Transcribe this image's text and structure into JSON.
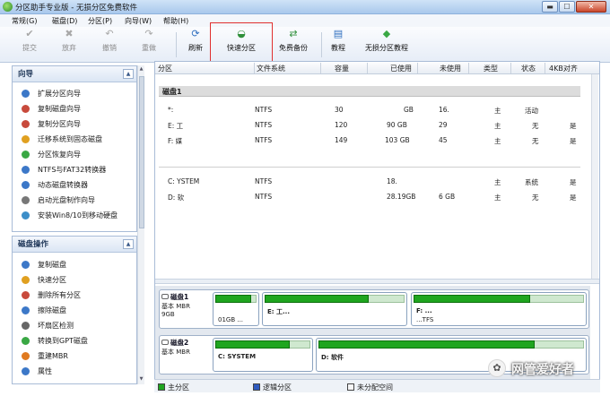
{
  "window": {
    "title": "分区助手专业版 - 无损分区免费软件",
    "min_label": "▬",
    "max_label": "☐",
    "close_label": "✕"
  },
  "menu": [
    "常规(G)",
    "磁盘(D)",
    "分区(P)",
    "向导(W)",
    "帮助(H)"
  ],
  "toolbar": [
    {
      "label": "提交",
      "icon": "commit-icon",
      "glyph": "✔",
      "enabled": false
    },
    {
      "label": "放弃",
      "icon": "discard-icon",
      "glyph": "✖",
      "enabled": false
    },
    {
      "label": "撤销",
      "icon": "undo-icon",
      "glyph": "↶",
      "enabled": false
    },
    {
      "label": "重做",
      "icon": "redo-icon",
      "glyph": "↷",
      "enabled": false
    },
    {
      "label": "刷新",
      "icon": "refresh-icon",
      "glyph": "⟳",
      "enabled": true
    },
    {
      "label": "快速分区",
      "icon": "quick-partition-icon",
      "glyph": "◒",
      "enabled": true
    },
    {
      "label": "免费备份",
      "icon": "backup-icon",
      "glyph": "⇄",
      "enabled": true
    },
    {
      "label": "教程",
      "icon": "tutorial-icon",
      "glyph": "▤",
      "enabled": true
    },
    {
      "label": "无损分区教程",
      "icon": "lossless-tutorial-icon",
      "glyph": "◆",
      "enabled": true
    }
  ],
  "sidebar": {
    "wizard": {
      "title": "向导",
      "items": [
        {
          "label": "扩展分区向导",
          "color": "#3c78c8"
        },
        {
          "label": "复制磁盘向导",
          "color": "#c84a3c"
        },
        {
          "label": "复制分区向导",
          "color": "#c84a3c"
        },
        {
          "label": "迁移系统到固态磁盘",
          "color": "#e0a020"
        },
        {
          "label": "分区恢复向导",
          "color": "#3aa844"
        },
        {
          "label": "NTFS与FAT32转换器",
          "color": "#3c78c8"
        },
        {
          "label": "动态磁盘转换器",
          "color": "#3c78c8"
        },
        {
          "label": "启动光盘制作向导",
          "color": "#777777"
        },
        {
          "label": "安装Win8/10到移动硬盘",
          "color": "#3c8ec8"
        }
      ]
    },
    "disk_ops": {
      "title": "磁盘操作",
      "items": [
        {
          "label": "复制磁盘",
          "color": "#3c78c8"
        },
        {
          "label": "快速分区",
          "color": "#e0a020"
        },
        {
          "label": "删除所有分区",
          "color": "#c84a3c"
        },
        {
          "label": "擦除磁盘",
          "color": "#3c78c8"
        },
        {
          "label": "坏扇区检测",
          "color": "#666666"
        },
        {
          "label": "转换到GPT磁盘",
          "color": "#3aa844"
        },
        {
          "label": "重建MBR",
          "color": "#e07a20"
        },
        {
          "label": "属性",
          "color": "#3c78c8"
        }
      ]
    }
  },
  "partition_table": {
    "columns": [
      "分区",
      "文件系统",
      "容量",
      "已使用",
      "未使用",
      "类型",
      "状态",
      "4KB对齐"
    ],
    "disk1_label": "磁盘1",
    "disk1_rows": [
      {
        "name": "*:",
        "fs": "NTFS",
        "cap": "30",
        "used": "GB",
        "free": "16.",
        "type": "主",
        "status": "活动",
        "align": ""
      },
      {
        "name": "E: 工",
        "fs": "NTFS",
        "cap": "120",
        "used": "90  GB",
        "free": "29",
        "type": "主",
        "status": "无",
        "align": "是"
      },
      {
        "name": "F: 媒",
        "fs": "NTFS",
        "cap": "149",
        "used": "103  GB",
        "free": "45",
        "type": "主",
        "status": "无",
        "align": "是"
      }
    ],
    "disk2_rows": [
      {
        "name": "C: YSTEM",
        "fs": "NTFS",
        "cap": "",
        "used": "18.",
        "free": "",
        "type": "主",
        "status": "系统",
        "align": "是"
      },
      {
        "name": "D: 软",
        "fs": "NTFS",
        "cap": "",
        "used": "28.19GB",
        "free": "6 GB",
        "type": "主",
        "status": "无",
        "align": "是"
      }
    ]
  },
  "disk_map": {
    "disk1": {
      "name": "磁盘1",
      "type": "基本 MBR",
      "size": "9GB",
      "parts": [
        {
          "label": "",
          "info": "01GB ...",
          "fill": 0.9
        },
        {
          "label": "E: 工...",
          "info": "",
          "fill": 0.75
        },
        {
          "label": "F: ...",
          "info": "...TFS",
          "fill": 0.69
        }
      ]
    },
    "disk2": {
      "name": "磁盘2",
      "type": "基本 MBR",
      "size": "",
      "parts": [
        {
          "label": "C: SYSTEM",
          "info": "",
          "fill": 0.8
        },
        {
          "label": "D: 软件",
          "info": "",
          "fill": 0.82
        }
      ]
    }
  },
  "status": {
    "legend": [
      {
        "label": "主分区",
        "color": "#1fa51f"
      },
      {
        "label": "逻辑分区",
        "color": "#2f5bbf"
      },
      {
        "label": "未分配空间",
        "color": "#f5f5f5"
      }
    ]
  },
  "watermark": {
    "icon_glyph": "✿",
    "text": "网管爱好者"
  }
}
